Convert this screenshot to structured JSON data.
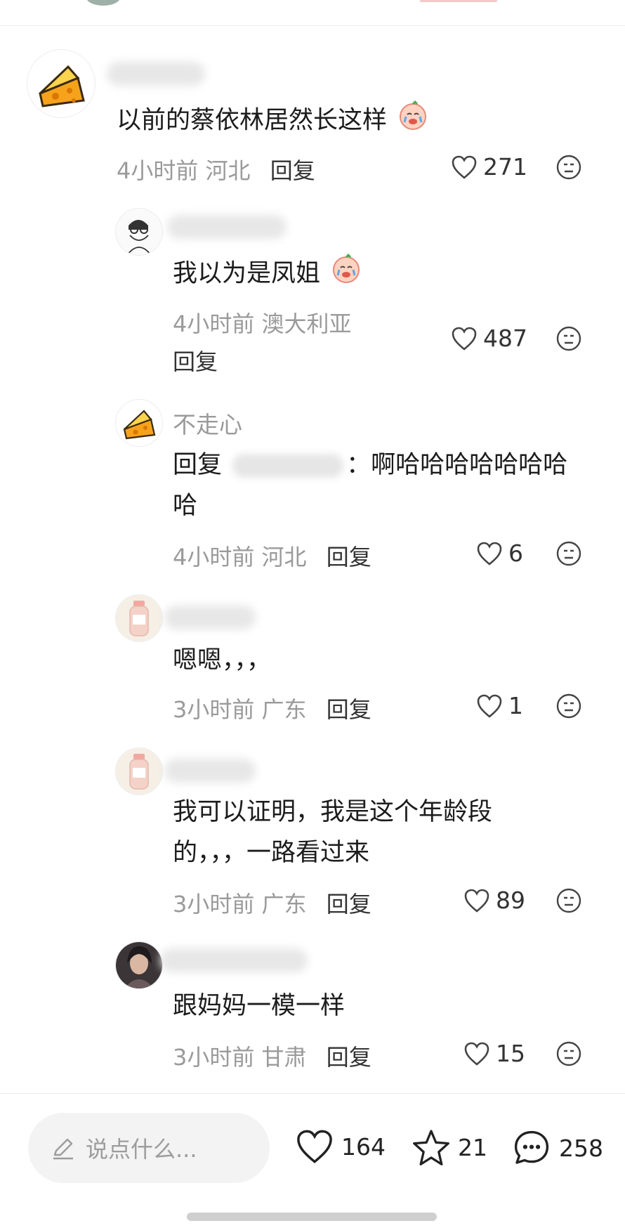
{
  "comments": [
    {
      "name": "",
      "text": "以前的蔡依林居然长这样",
      "time": "4小时前",
      "location": "河北",
      "reply_label": "回复",
      "likes": "271"
    },
    {
      "name": "",
      "text": "我以为是凤姐",
      "time": "4小时前",
      "location": "澳大利亚",
      "reply_label": "回复",
      "likes": "487"
    },
    {
      "name": "不走心",
      "reply_prefix": "回复",
      "text": "：啊哈哈哈哈哈哈哈",
      "text_line2": "哈",
      "time": "4小时前",
      "location": "河北",
      "reply_label": "回复",
      "likes": "6"
    },
    {
      "name": "",
      "text": "嗯嗯，，，",
      "time": "3小时前",
      "location": "广东",
      "reply_label": "回复",
      "likes": "1"
    },
    {
      "name": "",
      "text": "我可以证明，我是这个年龄段",
      "text_line2": "的，，，一路看过来",
      "time": "3小时前",
      "location": "广东",
      "reply_label": "回复",
      "likes": "89"
    },
    {
      "name": "",
      "text": "跟妈妈一模一样",
      "time": "3小时前",
      "location": "甘肃",
      "reply_label": "回复",
      "likes": "15"
    }
  ],
  "bottom_bar": {
    "input_placeholder": "说点什么...",
    "like_count": "164",
    "favorite_count": "21",
    "comment_count": "258"
  },
  "icons": {
    "like": "heart-outline-icon",
    "emoji": "neutral-face-icon",
    "edit": "pencil-icon",
    "favorite": "star-outline-icon",
    "comment": "chat-bubble-icon"
  },
  "colors": {
    "meta_text": "#9a9a9a",
    "body_text": "#1c1c1c",
    "input_bg": "#f3f3f3"
  }
}
